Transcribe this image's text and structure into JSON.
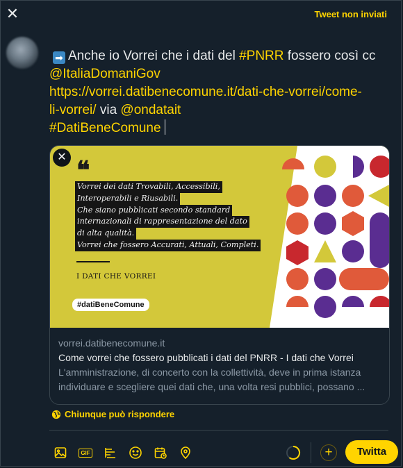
{
  "header": {
    "close_icon": "close-icon",
    "unsent_label": "Tweet non inviati"
  },
  "composer": {
    "avatar": "user-avatar",
    "emoji": "right-arrow-emoji",
    "line1_text": "Anche io Vorrei che i dati del ",
    "line1_hashtag": "#PNRR",
    "line1_rest": " fossero così cc",
    "mention1": "@ItaliaDomaniGov",
    "url_line1": "https://vorrei.datibenecomune.it/dati-che-vorrei/come-",
    "url_line2": "li-vorrei/",
    "via_text": " via ",
    "mention2": "@ondatait",
    "hashtag2": "#DatiBeneComune"
  },
  "link_card": {
    "image": {
      "quote_mark": "❝",
      "lines": [
        "Vorrei dei dati Trovabili, Accessibili,",
        "Interoperabili e Riusabili.",
        "Che siano pubblicati secondo standard",
        "internazionali di rappresentazione del dato",
        "di alta qualità.",
        "Vorrei che fossero Accurati, Attuali, Completi."
      ],
      "heading": "I DATI CHE VORREI",
      "pill": "#datiBeneComune",
      "accent_yellow": "#d3c83a",
      "pattern_colors": [
        "#e05a3a",
        "#5a2d91",
        "#d3c83a",
        "#c8282e"
      ]
    },
    "domain": "vorrei.datibenecomune.it",
    "title": "Come vorrei che fossero pubblicati i dati del PNRR - I dati che Vorrei",
    "description": "L'amministrazione, di concerto con la collettività, deve in prima istanza individuare e scegliere quei dati che, una volta resi pubblici, possano ..."
  },
  "reply_setting": {
    "icon": "globe-icon",
    "label": "Chiunque può rispondere"
  },
  "toolbar": {
    "items": [
      "media-icon",
      "gif-icon",
      "poll-icon",
      "emoji-icon",
      "schedule-icon",
      "location-icon"
    ],
    "gif_label": "GIF",
    "add_icon": "plus-icon",
    "tweet_label": "Twitta"
  },
  "colors": {
    "accent": "#ffd400",
    "background": "#15202b",
    "text": "#e7e9ea",
    "muted": "#8b98a5"
  }
}
